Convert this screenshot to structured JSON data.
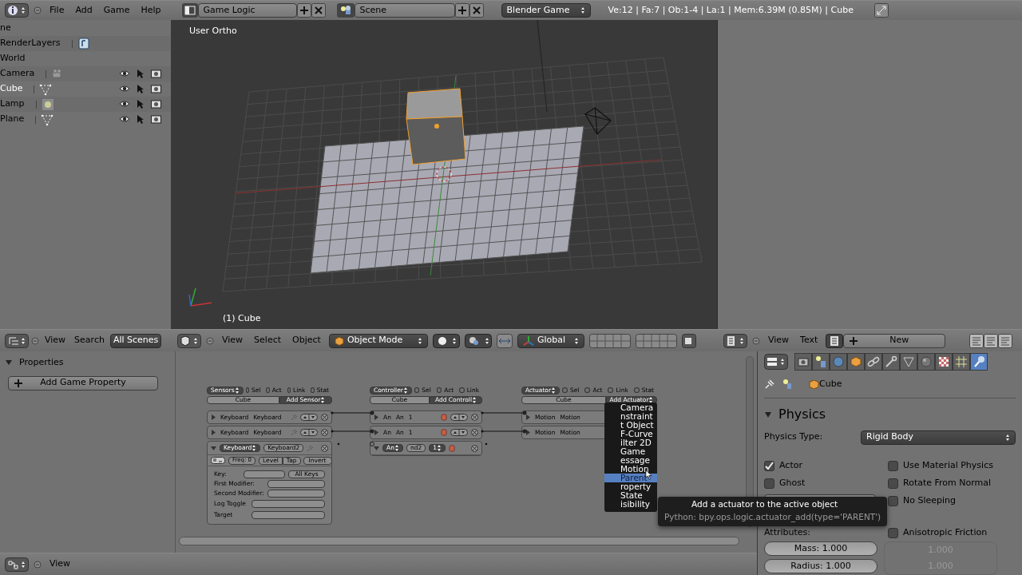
{
  "top_bar": {
    "menus": [
      "File",
      "Add",
      "Game",
      "Help"
    ],
    "screen_layout": "Game Logic",
    "scene": "Scene",
    "render_engine": "Blender Game",
    "stats": "Ve:12 | Fa:7 | Ob:1-4 | La:1 | Mem:6.39M (0.85M) | Cube"
  },
  "outliner": {
    "items": [
      {
        "name": "ne",
        "kind": "scene",
        "selected": false
      },
      {
        "name": "RenderLayers",
        "kind": "renderlayers",
        "selected": false
      },
      {
        "name": "World",
        "kind": "world",
        "selected": false
      },
      {
        "name": "Camera",
        "kind": "camera",
        "selected": false
      },
      {
        "name": "Cube",
        "kind": "mesh",
        "selected": true
      },
      {
        "name": "Lamp",
        "kind": "lamp",
        "selected": false
      },
      {
        "name": "Plane",
        "kind": "mesh",
        "selected": false
      }
    ],
    "header": {
      "menus": [
        "View",
        "Search"
      ],
      "filter": "All Scenes"
    }
  },
  "viewport": {
    "view_name": "User Ortho",
    "object_label": "(1) Cube",
    "header": {
      "menus": [
        "View",
        "Select",
        "Object"
      ],
      "mode": "Object Mode",
      "orientation": "Global"
    }
  },
  "text_editor": {
    "header": {
      "menus": [
        "View",
        "Text"
      ],
      "new_button": "New"
    }
  },
  "logic_editor": {
    "sidebar": {
      "panel": "Properties",
      "expanded": true,
      "button": "Add Game Property"
    },
    "columns": [
      {
        "kind": "sensors",
        "type": "Sensors",
        "filters": [
          {
            "label": "Sel",
            "checked": false
          },
          {
            "label": "Act",
            "checked": false
          },
          {
            "label": "Link",
            "checked": false
          },
          {
            "label": "Stat",
            "checked": false
          }
        ],
        "object": "Cube",
        "add": "Add Sensor",
        "bricks": [
          {
            "expanded": false,
            "type": "Keyboard",
            "name": "Keyboard"
          },
          {
            "expanded": false,
            "type": "Keyboard",
            "name": "Keyboard"
          },
          {
            "expanded": true,
            "type": "Keyboard",
            "name": "Keyboard2",
            "details": {
              "freq": "Freq: 0",
              "buttons": [
                "Level",
                "Tap",
                "Invert"
              ],
              "fields": [
                {
                  "label": "Key:",
                  "button": "All Keys"
                },
                {
                  "label": "First Modifier:"
                },
                {
                  "label": "Second Modifier:"
                },
                {
                  "label": "Log Toggle"
                },
                {
                  "label": "Target"
                }
              ]
            }
          }
        ]
      },
      {
        "kind": "controllers",
        "type": "Controller",
        "filters": [
          {
            "label": "Sel",
            "checked": false
          },
          {
            "label": "Act",
            "checked": false
          },
          {
            "label": "Link",
            "checked": false
          }
        ],
        "object": "Cube",
        "add": "Add Controll",
        "bricks": [
          {
            "expanded": false,
            "type": "An",
            "name": "An",
            "state": "1"
          },
          {
            "expanded": false,
            "type": "An",
            "name": "An",
            "state": "1"
          },
          {
            "expanded": true,
            "type": "An",
            "name": "nd2",
            "state": "1"
          }
        ]
      },
      {
        "kind": "actuators",
        "type": "Actuator",
        "filters": [
          {
            "label": "Sel",
            "checked": false
          },
          {
            "label": "Act",
            "checked": false
          },
          {
            "label": "Link",
            "checked": false
          },
          {
            "label": "Stat",
            "checked": false
          }
        ],
        "object": "Cube",
        "add": "Add Actuator",
        "bricks": [
          {
            "expanded": false,
            "type": "Motion",
            "name": "Motion"
          },
          {
            "expanded": false,
            "type": "Motion",
            "name": "Motion"
          }
        ]
      }
    ],
    "add_menu": {
      "items": [
        {
          "label": "Camera",
          "selected": false
        },
        {
          "label": "nstraint",
          "selected": false
        },
        {
          "label": "t Object",
          "selected": false
        },
        {
          "label": "F-Curve",
          "selected": false
        },
        {
          "label": "ilter 2D",
          "selected": false
        },
        {
          "label": "Game",
          "selected": false
        },
        {
          "label": "essage",
          "selected": false
        },
        {
          "label": "Motion",
          "selected": false
        },
        {
          "label": "Parent",
          "selected": true
        },
        {
          "label": "roperty",
          "selected": false
        },
        {
          "label": "State",
          "selected": false
        },
        {
          "label": "isibility",
          "selected": false
        }
      ]
    },
    "tooltip": {
      "title": "Add a actuator to the active object",
      "python": "Python: bpy.ops.logic.actuator_add(type='PARENT')"
    },
    "header": {
      "menus": [
        "View"
      ]
    }
  },
  "properties_editor": {
    "tabs": [
      {
        "selected": false
      },
      {
        "selected": false
      },
      {
        "selected": false
      },
      {
        "selected": false
      },
      {
        "selected": false
      },
      {
        "selected": false
      },
      {
        "selected": false
      },
      {
        "selected": false
      },
      {
        "selected": false
      },
      {
        "selected": false
      },
      {
        "selected": true
      }
    ],
    "breadcrumb": "Cube",
    "panel": {
      "title": "Physics",
      "expanded": true
    },
    "physics_type_label": "Physics Type:",
    "physics_type": "Rigid Body",
    "left_options": [
      {
        "label": "Actor",
        "checked": true
      },
      {
        "label": "Ghost",
        "checked": false
      }
    ],
    "right_options": [
      {
        "label": "Use Material Physics",
        "checked": false
      },
      {
        "label": "Rotate From Normal",
        "checked": false
      },
      {
        "label": "No Sleeping",
        "checked": false
      }
    ],
    "attributes_label": "Attributes:",
    "anisotropic": {
      "label": "Anisotropic Friction",
      "checked": false
    },
    "fields": [
      "Mass: 1.000",
      "Radius: 1.000"
    ],
    "friction_values": [
      "1.000",
      "1.000"
    ]
  }
}
